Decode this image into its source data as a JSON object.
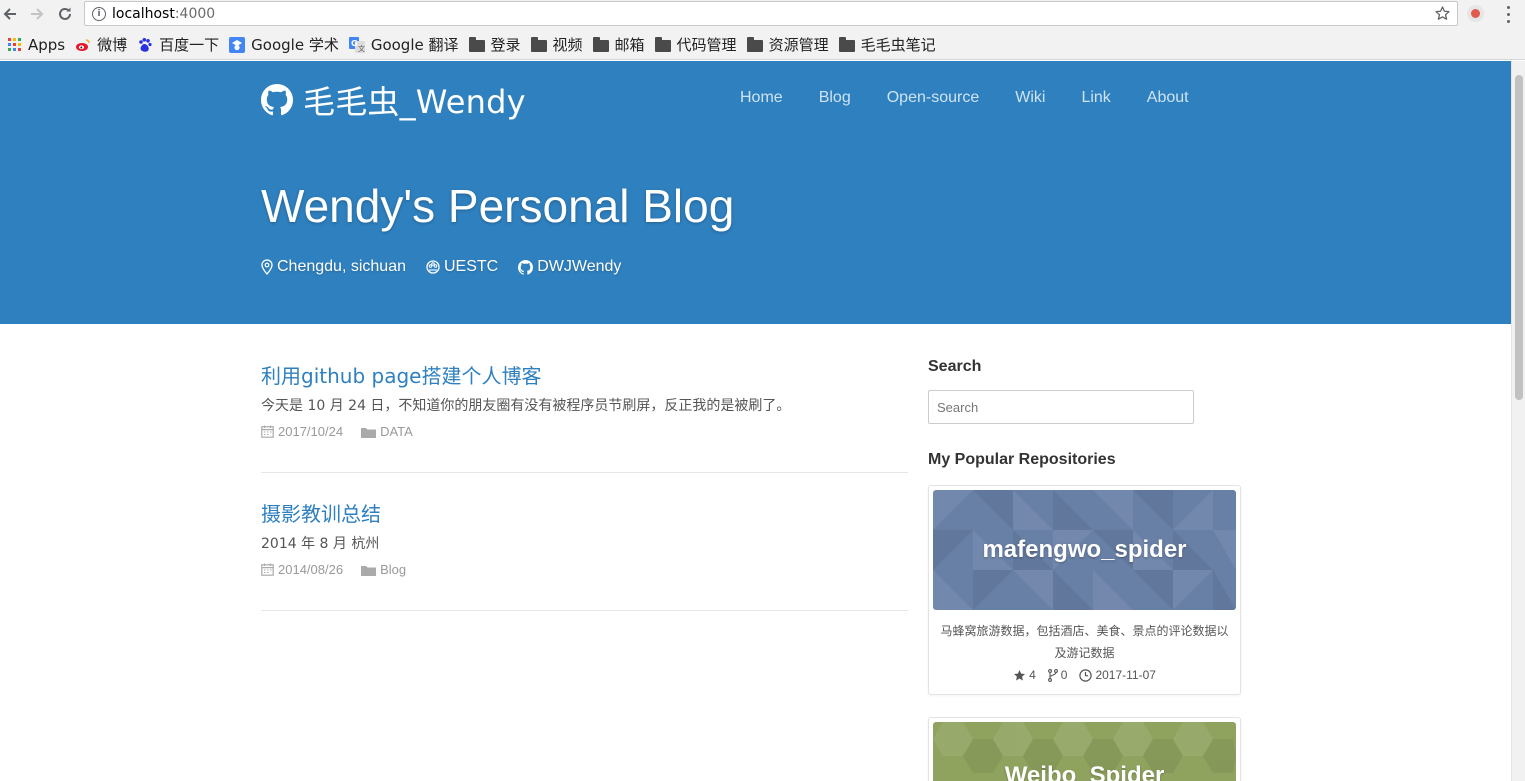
{
  "browser": {
    "url_host": "localhost",
    "url_port": ":4000",
    "bookmarks": [
      {
        "label": "Apps",
        "icon": "apps-grid-icon"
      },
      {
        "label": "微博",
        "icon": "weibo-icon"
      },
      {
        "label": "百度一下",
        "icon": "baidu-paw-icon"
      },
      {
        "label": "Google 学术",
        "icon": "google-scholar-icon"
      },
      {
        "label": "Google 翻译",
        "icon": "google-translate-icon"
      },
      {
        "label": "登录",
        "icon": "folder-icon"
      },
      {
        "label": "视频",
        "icon": "folder-icon"
      },
      {
        "label": "邮箱",
        "icon": "folder-icon"
      },
      {
        "label": "代码管理",
        "icon": "folder-icon"
      },
      {
        "label": "资源管理",
        "icon": "folder-icon"
      },
      {
        "label": "毛毛虫笔记",
        "icon": "folder-icon"
      }
    ]
  },
  "site": {
    "brand": "毛毛虫_Wendy",
    "nav": [
      "Home",
      "Blog",
      "Open-source",
      "Wiki",
      "Link",
      "About"
    ],
    "hero_title": "Wendy's Personal Blog",
    "location": "Chengdu, sichuan",
    "school": "UESTC",
    "github": "DWJWendy",
    "colors": {
      "header_bg": "#2f80bf",
      "link": "#2f80bf"
    }
  },
  "posts": [
    {
      "title": "利用github page搭建个人博客",
      "excerpt": "今天是 10 月 24 日，不知道你的朋友圈有没有被程序员节刷屏，反正我的是被刷了。",
      "date": "2017/10/24",
      "category": "DATA"
    },
    {
      "title": "摄影教训总结",
      "excerpt": "2014 年 8 月 杭州",
      "date": "2014/08/26",
      "category": "Blog"
    }
  ],
  "sidebar": {
    "search_heading": "Search",
    "search_placeholder": "Search",
    "repos_heading": "My Popular Repositories",
    "repos": [
      {
        "name": "mafengwo_spider",
        "description": "马蜂窝旅游数据，包括酒店、美食、景点的评论数据以及游记数据",
        "stars": "4",
        "forks": "0",
        "updated": "2017-11-07",
        "banner_color": "#687fa6"
      },
      {
        "name": "Weibo_Spider",
        "banner_color": "#8fa35f"
      }
    ]
  }
}
